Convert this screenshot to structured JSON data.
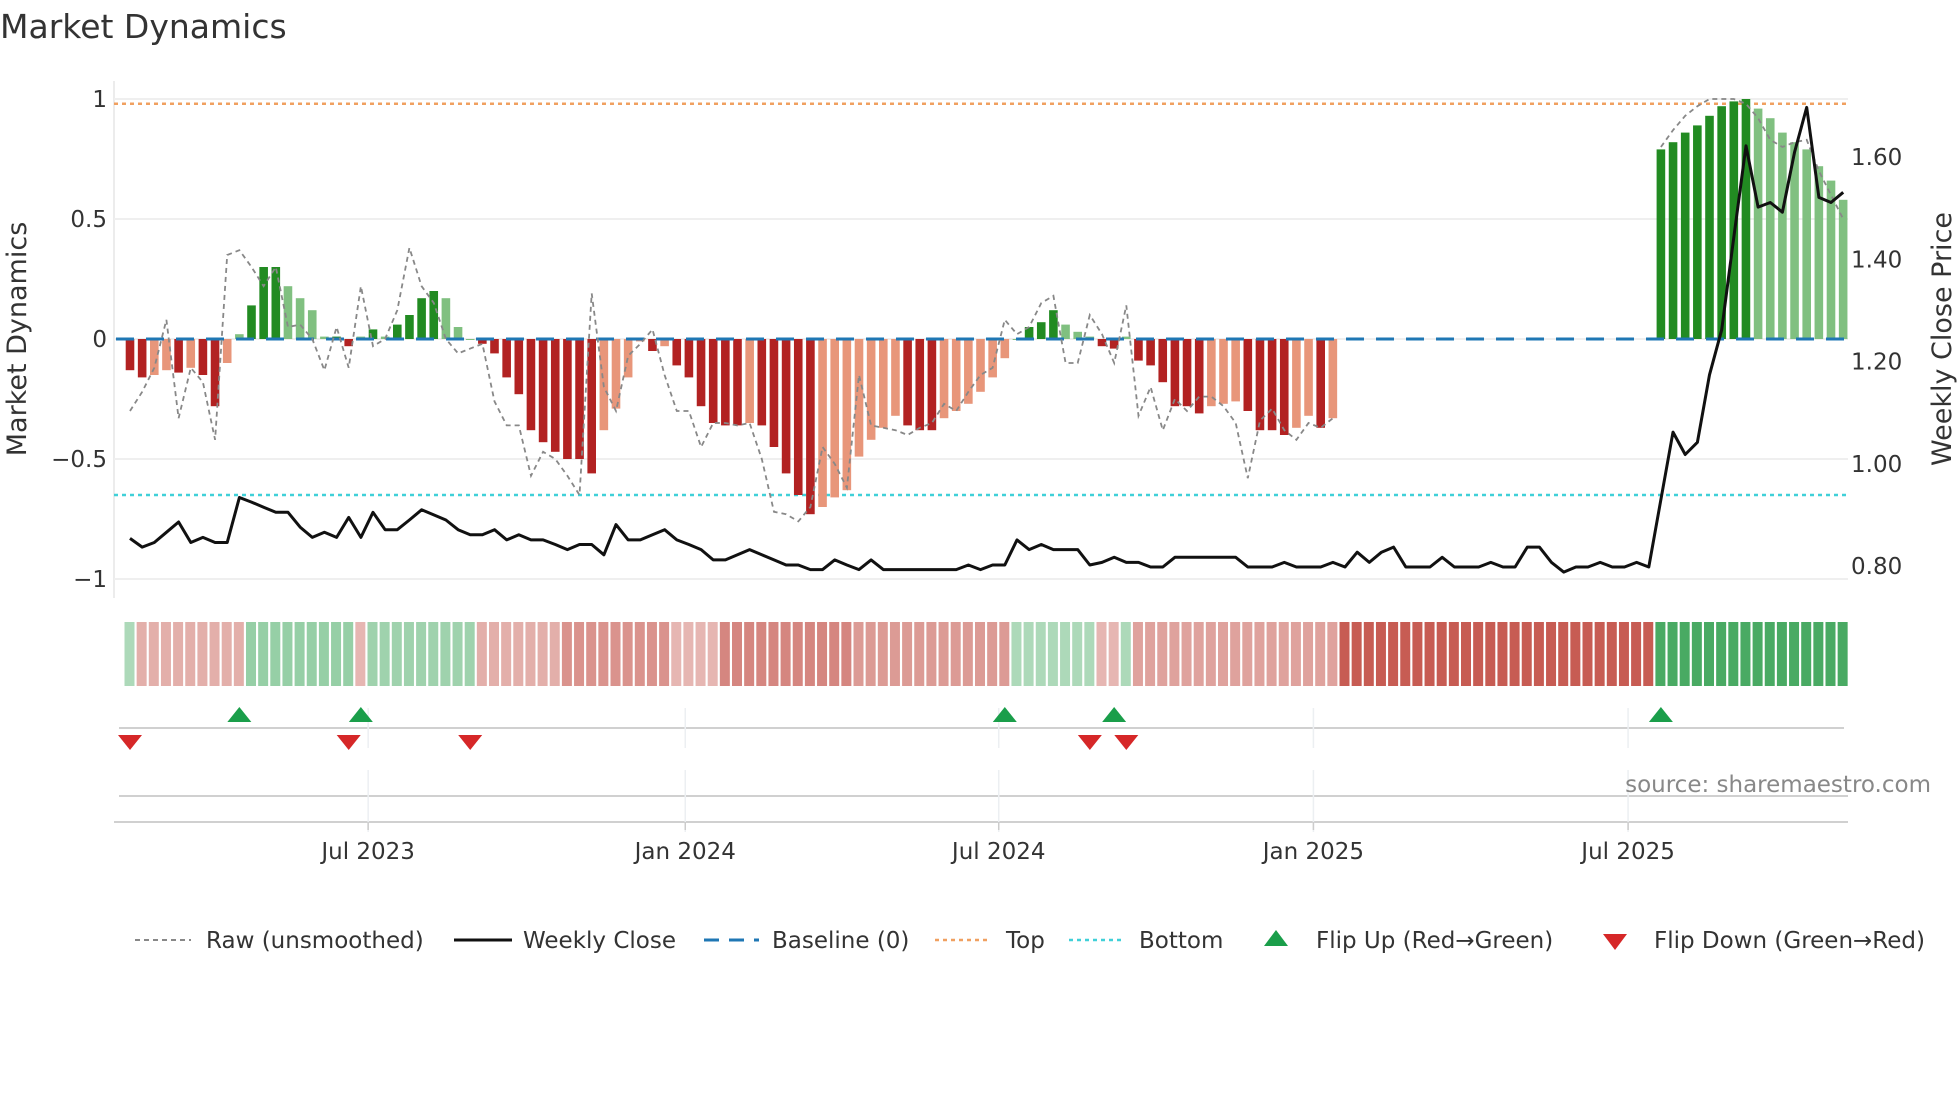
{
  "chart_data": {
    "type": "bar",
    "title": "Market Dynamics",
    "ylabel": "Market Dynamics",
    "y2label": "Weekly Close Price",
    "ylim": [
      -1.05,
      1.1
    ],
    "y2lim": [
      0.77,
      1.74
    ],
    "x_unit": "week index",
    "yticks": [
      {
        "v": 1,
        "label": "1"
      },
      {
        "v": 0.5,
        "label": "0.5"
      },
      {
        "v": 0,
        "label": "0"
      },
      {
        "v": -0.5,
        "label": "−0.5"
      },
      {
        "v": -1,
        "label": "−1"
      }
    ],
    "y2ticks": [
      {
        "v": 1.6,
        "label": "1.60"
      },
      {
        "v": 1.4,
        "label": "1.40"
      },
      {
        "v": 1.2,
        "label": "1.20"
      },
      {
        "v": 1.0,
        "label": "1.00"
      },
      {
        "v": 0.8,
        "label": "0.80"
      }
    ],
    "xticks": [
      {
        "v": 19.6,
        "label": "Jul 2023"
      },
      {
        "v": 45.7,
        "label": "Jan 2024"
      },
      {
        "v": 71.5,
        "label": "Jul 2024"
      },
      {
        "v": 97.4,
        "label": "Jan 2025"
      },
      {
        "v": 123.3,
        "label": "Jul 2025"
      }
    ],
    "top_level": 0.98,
    "bottom_level": -0.65,
    "baseline": 0,
    "smoothed": [
      -0.13,
      -0.16,
      -0.15,
      -0.13,
      -0.14,
      -0.12,
      -0.15,
      -0.28,
      -0.1,
      0.02,
      0.14,
      0.3,
      0.3,
      0.22,
      0.17,
      0.12,
      0.01,
      0.01,
      -0.03,
      0.01,
      0.04,
      0.01,
      0.06,
      0.1,
      0.17,
      0.2,
      0.17,
      0.05,
      0.0,
      -0.02,
      -0.06,
      -0.16,
      -0.23,
      -0.38,
      -0.43,
      -0.47,
      -0.5,
      -0.5,
      -0.56,
      -0.38,
      -0.29,
      -0.16,
      -0.01,
      -0.05,
      -0.03,
      -0.11,
      -0.16,
      -0.28,
      -0.35,
      -0.36,
      -0.36,
      -0.35,
      -0.36,
      -0.45,
      -0.56,
      -0.65,
      -0.73,
      -0.7,
      -0.66,
      -0.63,
      -0.49,
      -0.42,
      -0.37,
      -0.32,
      -0.36,
      -0.38,
      -0.38,
      -0.33,
      -0.3,
      -0.27,
      -0.22,
      -0.16,
      -0.08,
      0.0,
      0.05,
      0.07,
      0.12,
      0.06,
      0.03,
      0.01,
      -0.03,
      -0.04,
      0.01,
      -0.09,
      -0.11,
      -0.18,
      -0.28,
      -0.28,
      -0.31,
      -0.28,
      -0.27,
      -0.26,
      -0.3,
      -0.38,
      -0.38,
      -0.4,
      -0.37,
      -0.32,
      -0.37,
      -0.33,
      null,
      null,
      null,
      null,
      null,
      null,
      null,
      null,
      null,
      null,
      null,
      null,
      null,
      null,
      null,
      null,
      null,
      null,
      null,
      null,
      null,
      null,
      null,
      null,
      null,
      null,
      0.79,
      0.82,
      0.86,
      0.89,
      0.93,
      0.97,
      0.99,
      1.0,
      0.96,
      0.92,
      0.86,
      0.82,
      0.79,
      0.72,
      0.66,
      0.58
    ],
    "raw": [
      -0.3,
      -0.22,
      -0.12,
      0.08,
      -0.33,
      -0.12,
      -0.18,
      -0.42,
      0.35,
      0.37,
      0.3,
      0.22,
      0.3,
      0.05,
      0.06,
      0.0,
      -0.13,
      0.05,
      -0.12,
      0.22,
      -0.03,
      0.0,
      0.12,
      0.38,
      0.22,
      0.15,
      0.0,
      -0.06,
      -0.04,
      -0.02,
      -0.26,
      -0.36,
      -0.36,
      -0.57,
      -0.47,
      -0.5,
      -0.57,
      -0.65,
      0.19,
      -0.2,
      -0.3,
      -0.07,
      -0.02,
      0.04,
      -0.15,
      -0.3,
      -0.3,
      -0.45,
      -0.35,
      -0.35,
      -0.36,
      -0.35,
      -0.5,
      -0.72,
      -0.73,
      -0.76,
      -0.7,
      -0.45,
      -0.52,
      -0.62,
      -0.15,
      -0.36,
      -0.37,
      -0.38,
      -0.4,
      -0.37,
      -0.35,
      -0.27,
      -0.3,
      -0.22,
      -0.15,
      -0.12,
      0.08,
      0.02,
      0.05,
      0.15,
      0.18,
      -0.1,
      -0.1,
      0.1,
      0.02,
      -0.1,
      0.14,
      -0.32,
      -0.2,
      -0.38,
      -0.25,
      -0.3,
      -0.24,
      -0.24,
      -0.28,
      -0.35,
      -0.58,
      -0.34,
      -0.29,
      -0.38,
      -0.42,
      -0.35,
      -0.37,
      -0.33,
      null,
      null,
      null,
      null,
      null,
      null,
      null,
      null,
      null,
      null,
      null,
      null,
      null,
      null,
      null,
      null,
      null,
      null,
      null,
      null,
      null,
      null,
      null,
      null,
      null,
      null,
      0.8,
      0.87,
      0.93,
      0.97,
      1.0,
      1.0,
      1.0,
      0.98,
      0.92,
      0.83,
      0.8,
      0.82,
      0.83,
      0.7,
      0.6,
      0.5
    ],
    "weekly_close": [
      0.854,
      0.837,
      0.846,
      0.866,
      0.886,
      0.846,
      0.856,
      0.846,
      0.846,
      0.934,
      0.925,
      0.915,
      0.905,
      0.905,
      0.876,
      0.856,
      0.866,
      0.856,
      0.895,
      0.856,
      0.905,
      0.871,
      0.871,
      0.89,
      0.91,
      0.9,
      0.89,
      0.871,
      0.861,
      0.861,
      0.871,
      0.851,
      0.861,
      0.851,
      0.851,
      0.842,
      0.832,
      0.842,
      0.842,
      0.822,
      0.881,
      0.851,
      0.851,
      0.861,
      0.871,
      0.851,
      0.842,
      0.832,
      0.812,
      0.812,
      0.822,
      0.832,
      0.822,
      0.812,
      0.802,
      0.802,
      0.793,
      0.793,
      0.812,
      0.802,
      0.793,
      0.812,
      0.793,
      0.793,
      0.793,
      0.793,
      0.793,
      0.793,
      0.793,
      0.802,
      0.793,
      0.802,
      0.802,
      0.851,
      0.832,
      0.842,
      0.832,
      0.832,
      0.832,
      0.802,
      0.807,
      0.817,
      0.807,
      0.807,
      0.798,
      0.798,
      0.817,
      0.817,
      0.817,
      0.817,
      0.817,
      0.817,
      0.798,
      0.798,
      0.798,
      0.807,
      0.798,
      0.798,
      0.798,
      0.807,
      0.798,
      0.827,
      0.807,
      0.827,
      0.837,
      0.798,
      0.798,
      0.798,
      0.817,
      0.798,
      0.798,
      0.798,
      0.807,
      0.798,
      0.798,
      0.837,
      0.837,
      0.807,
      0.788,
      0.798,
      0.798,
      0.807,
      0.798,
      0.798,
      0.807,
      0.798,
      0.93,
      1.062,
      1.018,
      1.042,
      1.174,
      1.262,
      1.443,
      1.622,
      1.502,
      1.511,
      1.492,
      1.609,
      1.697,
      1.521,
      1.511,
      1.531
    ],
    "regime_strip": [
      {
        "n": 1,
        "v": 0.2
      },
      {
        "n": 9,
        "v": -0.25
      },
      {
        "n": 9,
        "v": 0.35
      },
      {
        "n": 1,
        "v": -0.2
      },
      {
        "n": 9,
        "v": 0.3
      },
      {
        "n": 7,
        "v": -0.25
      },
      {
        "n": 9,
        "v": -0.45
      },
      {
        "n": 4,
        "v": -0.2
      },
      {
        "n": 11,
        "v": -0.55
      },
      {
        "n": 13,
        "v": -0.4
      },
      {
        "n": 7,
        "v": 0.2
      },
      {
        "n": 2,
        "v": -0.2
      },
      {
        "n": 1,
        "v": 0.2
      },
      {
        "n": 17,
        "v": -0.35
      },
      {
        "n": 26,
        "v": -0.85
      },
      {
        "n": 16,
        "v": 0.85
      }
    ],
    "flip_up": [
      9,
      19,
      72,
      81,
      126
    ],
    "flip_down": [
      0,
      18,
      28,
      79,
      82
    ],
    "colors": {
      "up_strong": "#228b22",
      "up_weak": "#80c080",
      "down_strong": "#b22222",
      "down_weak": "#e8967a",
      "top": "#f0a060",
      "bottom": "#40d0d8",
      "baseline": "#1f77b4",
      "raw": "#888888",
      "close": "#111111",
      "flip_up": "#1a9e4a",
      "flip_down": "#d62728"
    },
    "legend": [
      "Raw (unsmoothed)",
      "Weekly Close",
      "Baseline (0)",
      "Top",
      "Bottom",
      "Flip Up (Red→Green)",
      "Flip Down (Green→Red)"
    ],
    "source": "source: sharemaestro.com"
  }
}
